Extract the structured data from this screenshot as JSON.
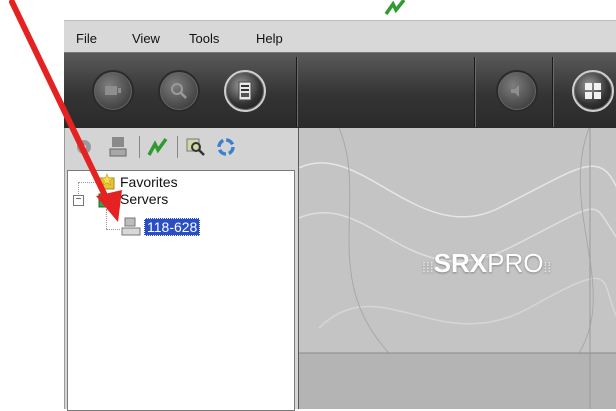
{
  "menu": {
    "items": [
      "File",
      "View",
      "Tools",
      "Help"
    ]
  },
  "toolbar": {
    "icons": [
      "monitor-icon",
      "search-icon",
      "server-info-icon",
      "speaker-icon",
      "grid-layout-icon"
    ]
  },
  "left_toolbar": {
    "icons": [
      "disk-icon",
      "server-icon",
      "activity-icon",
      "find-icon",
      "refresh-icon"
    ]
  },
  "tree": {
    "favorites_label": "Favorites",
    "servers_label": "Servers",
    "expander_symbol": "−",
    "selected_server": "118-628"
  },
  "main": {
    "logo_bold": "SRX",
    "logo_light": "PRO"
  },
  "colors": {
    "selection": "#2a4fc2",
    "annotation_arrow": "#e52222",
    "toolbar_bg": "#3a3a3a"
  }
}
